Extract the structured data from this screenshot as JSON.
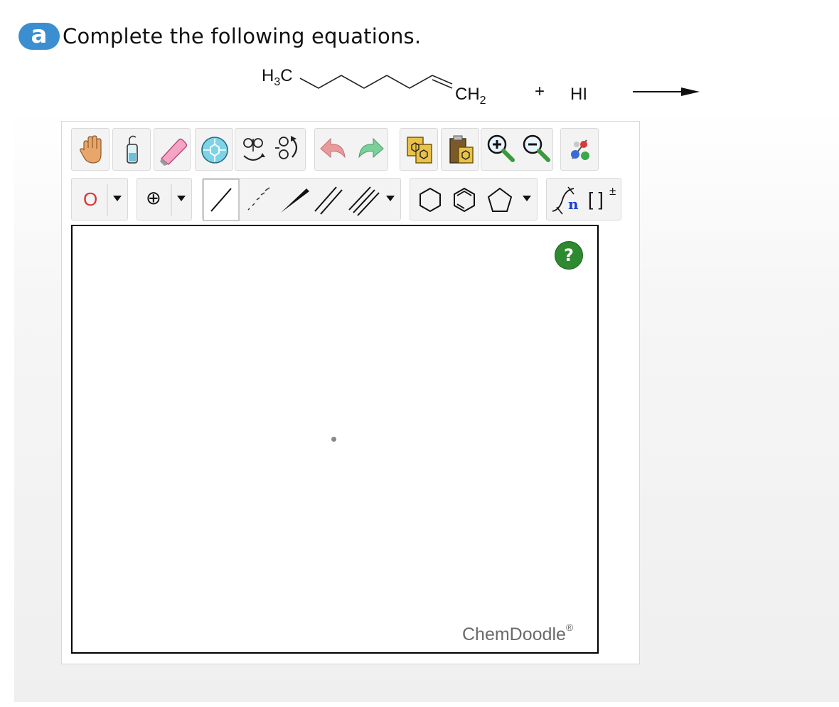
{
  "question": {
    "badge": "a",
    "prompt": "Complete the following equations."
  },
  "equation": {
    "reactant_start": "H3C",
    "reactant_end": "CH2",
    "plus": "+",
    "reagent": "HI"
  },
  "toolbar": {
    "icons": [
      "hand-pan-icon",
      "lasso-select-icon",
      "eraser-icon",
      "center-icon",
      "flip-icon",
      "rotate-icon",
      "undo-icon",
      "redo-icon",
      "copy-icon",
      "paste-icon",
      "zoom-in-icon",
      "zoom-out-icon",
      "clean-icon"
    ],
    "row2": {
      "atom_label": "O",
      "charge_symbol": "⊕",
      "bracket_label": "[ ]",
      "bracket_charge": "±",
      "repeat_unit_label": "n"
    }
  },
  "canvas": {
    "help_label": "?",
    "watermark": "ChemDoodle",
    "watermark_mark": "®"
  },
  "colors": {
    "badge": "#3b8fd0",
    "help_green": "#2e8a2e",
    "atom_red": "#d33",
    "repeat_blue": "#1a3fd6"
  }
}
